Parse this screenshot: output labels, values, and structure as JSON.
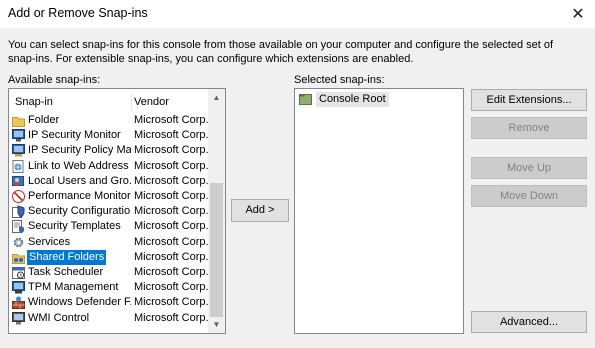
{
  "window": {
    "title": "Add or Remove Snap-ins",
    "close_glyph": "✕"
  },
  "description": "You can select snap-ins for this console from those available on your computer and configure the selected set of snap-ins. For extensible snap-ins, you can configure which extensions are enabled.",
  "available": {
    "label": "Available snap-ins:",
    "columns": {
      "snapin": "Snap-in",
      "vendor": "Vendor"
    },
    "items": [
      {
        "name": "Folder",
        "vendor": "Microsoft Corp...",
        "icon": "folder-icon"
      },
      {
        "name": "IP Security Monitor",
        "vendor": "Microsoft Corp...",
        "icon": "ip-security-monitor-icon"
      },
      {
        "name": "IP Security Policy Ma...",
        "vendor": "Microsoft Corp...",
        "icon": "ip-security-policy-icon"
      },
      {
        "name": "Link to Web Address",
        "vendor": "Microsoft Corp...",
        "icon": "web-link-icon"
      },
      {
        "name": "Local Users and Gro...",
        "vendor": "Microsoft Corp...",
        "icon": "users-icon"
      },
      {
        "name": "Performance Monitor",
        "vendor": "Microsoft Corp...",
        "icon": "performance-monitor-icon"
      },
      {
        "name": "Security Configuratio...",
        "vendor": "Microsoft Corp...",
        "icon": "security-config-icon"
      },
      {
        "name": "Security Templates",
        "vendor": "Microsoft Corp...",
        "icon": "security-templates-icon"
      },
      {
        "name": "Services",
        "vendor": "Microsoft Corp...",
        "icon": "services-gear-icon"
      },
      {
        "name": "Shared Folders",
        "vendor": "Microsoft Corp...",
        "icon": "shared-folders-icon",
        "selected": true
      },
      {
        "name": "Task Scheduler",
        "vendor": "Microsoft Corp...",
        "icon": "task-scheduler-icon"
      },
      {
        "name": "TPM Management",
        "vendor": "Microsoft Corp...",
        "icon": "tpm-chip-icon"
      },
      {
        "name": "Windows Defender F...",
        "vendor": "Microsoft Corp...",
        "icon": "firewall-icon"
      },
      {
        "name": "WMI Control",
        "vendor": "Microsoft Corp...",
        "icon": "wmi-control-icon"
      }
    ]
  },
  "add_button": "Add >",
  "selected": {
    "label": "Selected snap-ins:",
    "items": [
      {
        "name": "Console Root",
        "icon": "console-root-folder-icon"
      }
    ]
  },
  "buttons": {
    "edit_extensions": "Edit Extensions...",
    "remove": "Remove",
    "move_up": "Move Up",
    "move_down": "Move Down",
    "advanced": "Advanced..."
  },
  "colors": {
    "selection": "#0078d7",
    "window_bg": "#f0f0f0"
  }
}
